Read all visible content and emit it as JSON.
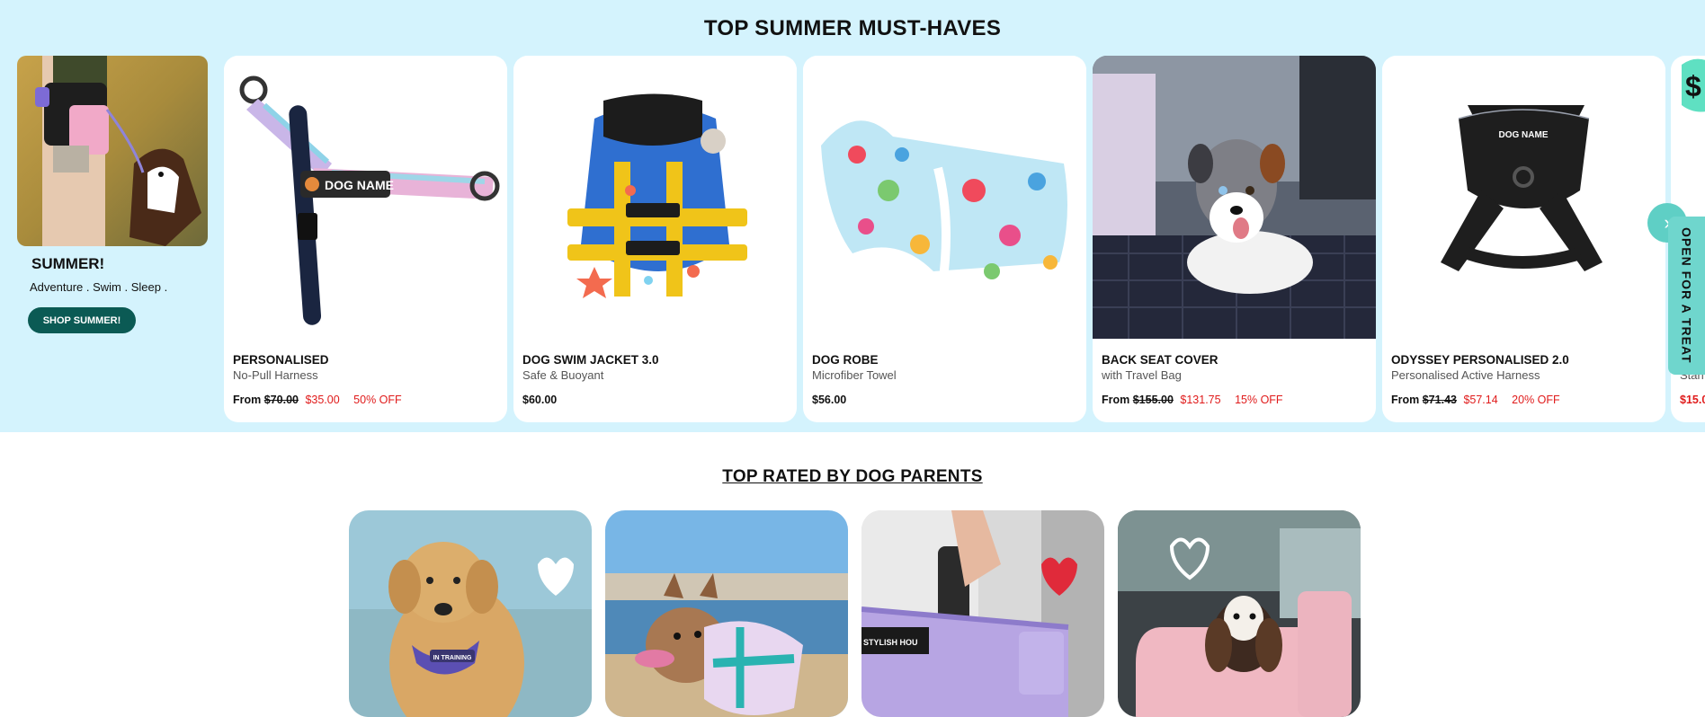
{
  "summer_section": {
    "title": "TOP SUMMER MUST-HAVES",
    "promo": {
      "title": "SUMMER!",
      "subtitle": "Adventure . Swim . Sleep .",
      "button_label": "SHOP SUMMER!"
    },
    "products": [
      {
        "name": "PERSONALISED",
        "desc": "No-Pull Harness",
        "from": "From",
        "was": "$70.00",
        "price": "$35.00",
        "off": "50% OFF"
      },
      {
        "name": "DOG SWIM JACKET 3.0",
        "desc": "Safe & Buoyant",
        "from": "",
        "was": "",
        "price": "$60.00",
        "off": ""
      },
      {
        "name": "DOG ROBE",
        "desc": "Microfiber Towel",
        "from": "",
        "was": "",
        "price": "$56.00",
        "off": ""
      },
      {
        "name": "BACK SEAT COVER",
        "desc": "with Travel Bag",
        "from": "From",
        "was": "$155.00",
        "price": "$131.75",
        "off": "15% OFF"
      },
      {
        "name": "ODYSSEY PERSONALISED 2.0",
        "desc": "Personalised Active Harness",
        "from": "From",
        "was": "$71.43",
        "price": "$57.14",
        "off": "20% OFF"
      }
    ],
    "partial_card": {
      "desc": "Stan",
      "price": "$15.0"
    },
    "image_labels": {
      "harness_tag": "DOG NAME",
      "odyssey_tag": "DOG NAME"
    }
  },
  "carousel": {
    "next_icon": "chevron-right-icon"
  },
  "treat_tab": {
    "label": "OPEN FOR A TREAT"
  },
  "rated_section": {
    "title": "TOP RATED BY DOG PARENTS",
    "image_labels": {
      "harness_text": "IN TRAINING",
      "bag_text": "STYLISH HOU"
    }
  },
  "colors": {
    "section_bg": "#d4f3fd",
    "button_bg": "#0b5a54",
    "sale_red": "#e01b1b",
    "accent_teal": "#6fd6cd"
  }
}
